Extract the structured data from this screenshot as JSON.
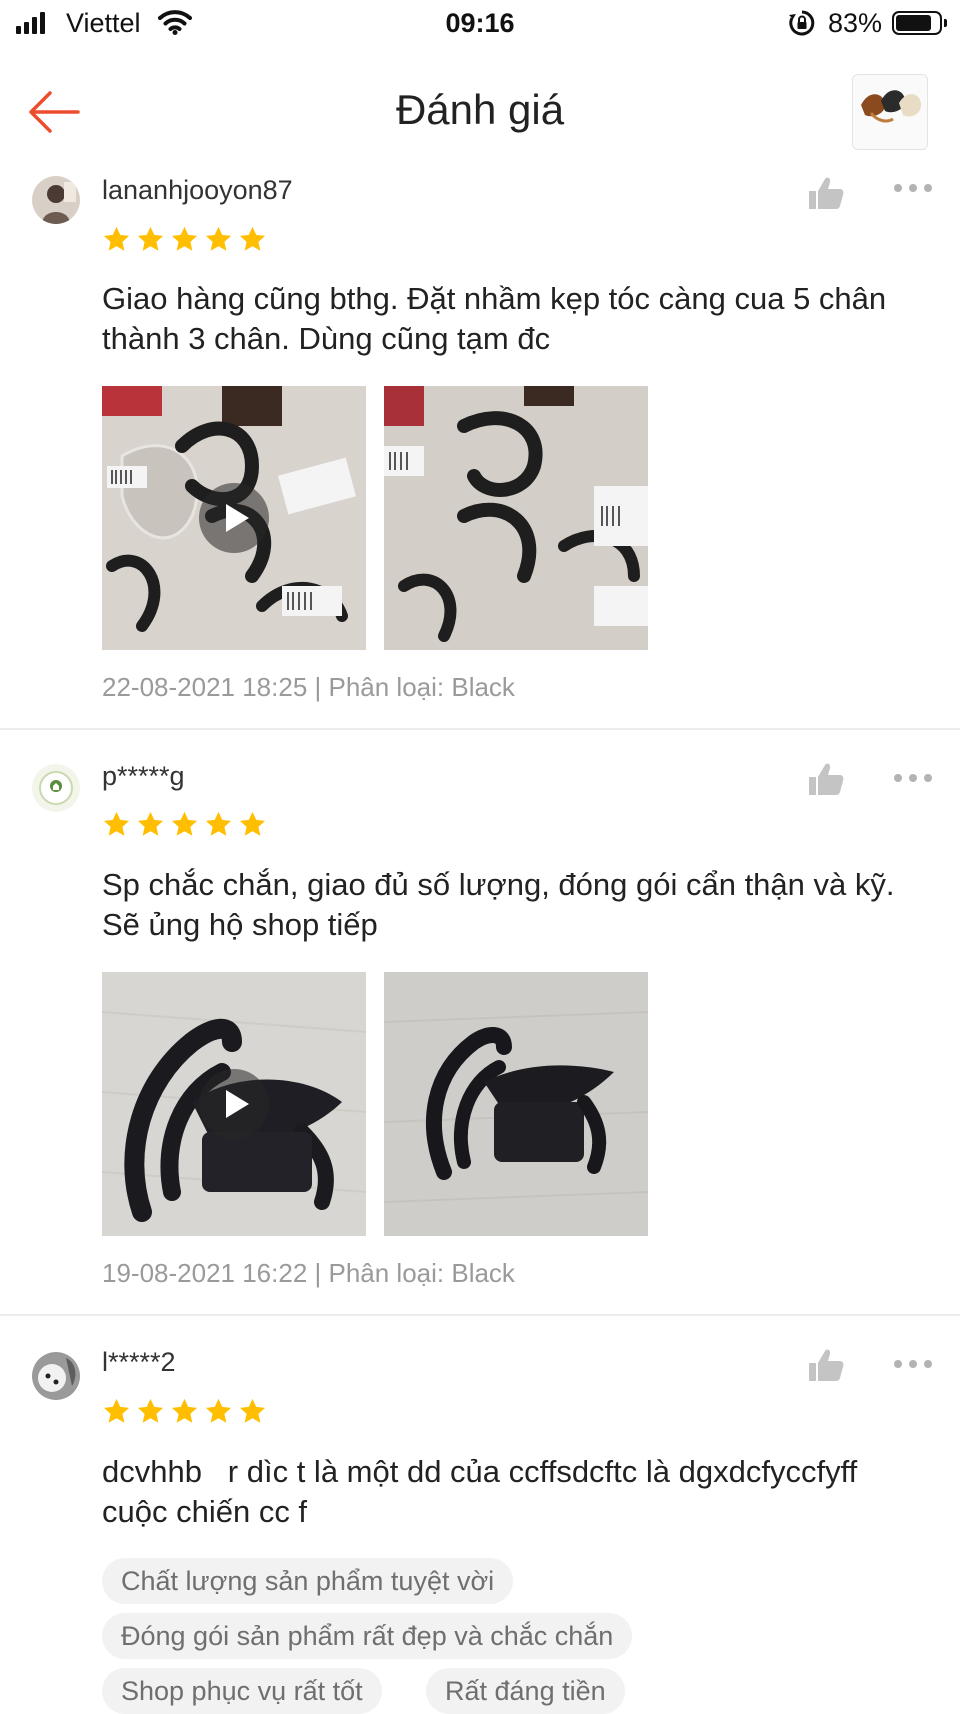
{
  "status_bar": {
    "carrier": "Viettel",
    "time": "09:16",
    "battery_percent": "83%",
    "battery_level": 0.83,
    "signal_icon": "cellular-signal-icon",
    "wifi_icon": "wifi-icon",
    "orientation_lock_icon": "orientation-lock-icon"
  },
  "header": {
    "title": "Đánh giá",
    "back_icon": "arrow-left-icon",
    "accent_color": "#ee4d2d"
  },
  "colors": {
    "star": "#ffbf00",
    "meta_text": "#9a9a9a",
    "tag_background": "#f2f2f2"
  },
  "reviews": [
    {
      "username": "lananhjooyon87",
      "rating": 5,
      "text": "Giao hàng cũng bthg. Đặt nhầm kẹp tóc càng cua 5 chân thành 3 chân. Dùng cũng tạm đc",
      "media": [
        {
          "kind": "video",
          "icon": "play-icon"
        },
        {
          "kind": "photo"
        }
      ],
      "meta": "22-08-2021 18:25 | Phân loại: Black"
    },
    {
      "username": "p*****g",
      "rating": 5,
      "text": "Sp chắc chắn, giao đủ số lượng, đóng gói cẩn thận và kỹ. Sẽ ủng hộ shop tiếp",
      "media": [
        {
          "kind": "video",
          "icon": "play-icon"
        },
        {
          "kind": "photo"
        }
      ],
      "meta": "19-08-2021 16:22 | Phân loại: Black"
    },
    {
      "username": "l*****2",
      "rating": 5,
      "text": "dcvhhb   r dìc t là một dd của ccffsdcftc là dgxdcfyccfyff cuộc chiến cc f",
      "tags": [
        "Chất lượng sản phẩm tuyệt vời",
        "Đóng gói sản phẩm rất đẹp và chắc chắn",
        "Shop phục vụ rất tốt",
        "Rất đáng tiền"
      ]
    }
  ]
}
